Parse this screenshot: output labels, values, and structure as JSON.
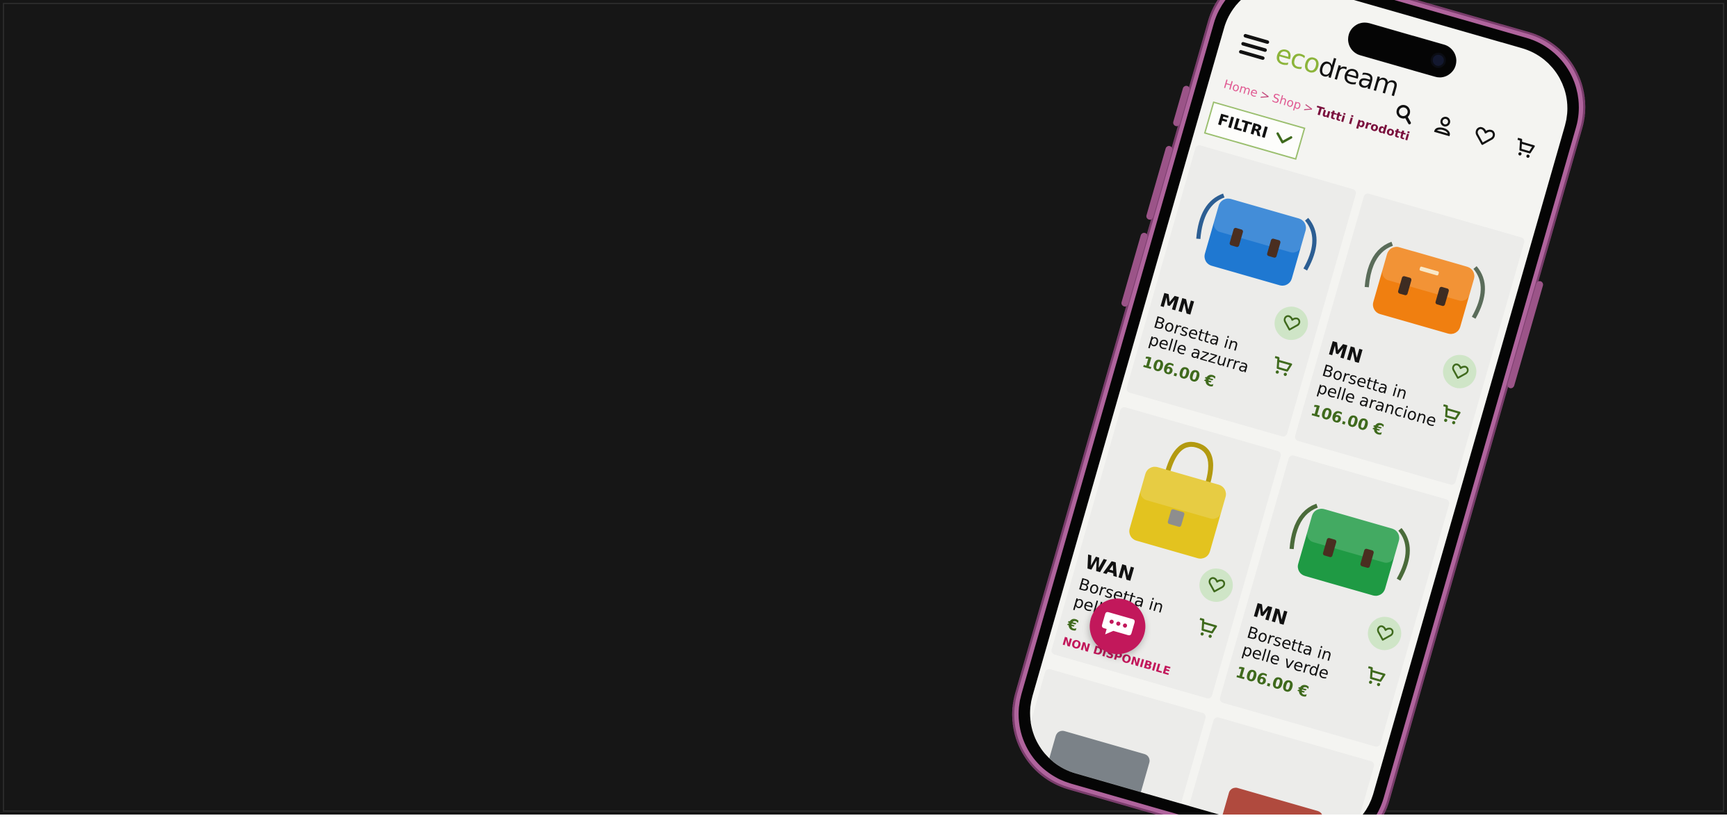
{
  "brand": {
    "logo_part1": "eco",
    "logo_part2": "dream"
  },
  "header": {
    "icons": [
      "hamburger-menu-icon",
      "search-icon",
      "user-icon",
      "heart-icon",
      "cart-icon"
    ]
  },
  "breadcrumb": {
    "home": "Home",
    "sep1": ">",
    "shop": "Shop",
    "sep2": ">",
    "current": "Tutti i prodotti"
  },
  "filter": {
    "label": "FILTRI"
  },
  "products": [
    {
      "brand": "MN",
      "name": "Borsetta in pelle azzurra",
      "price": "106.00 €",
      "color": "#1f78d1",
      "status": ""
    },
    {
      "brand": "MN",
      "name": "Borsetta in pelle arancione",
      "price": "106.00 €",
      "color": "#f07f10",
      "status": ""
    },
    {
      "brand": "WAN",
      "name": "Borsetta in pelle",
      "price": "€",
      "color": "#e3c31f",
      "status": "NON DISPONIBILE"
    },
    {
      "brand": "MN",
      "name": "Borsetta in pelle verde",
      "price": "106.00 €",
      "color": "#1f9a44",
      "status": ""
    }
  ],
  "colors": {
    "stage_bg": "#161616",
    "phone_frame": "#b0649d",
    "accent_green": "#3f6a1d",
    "logo_green": "#8cb43a",
    "breadcrumb_pink": "#e05a92",
    "chat_magenta": "#c2185b"
  }
}
